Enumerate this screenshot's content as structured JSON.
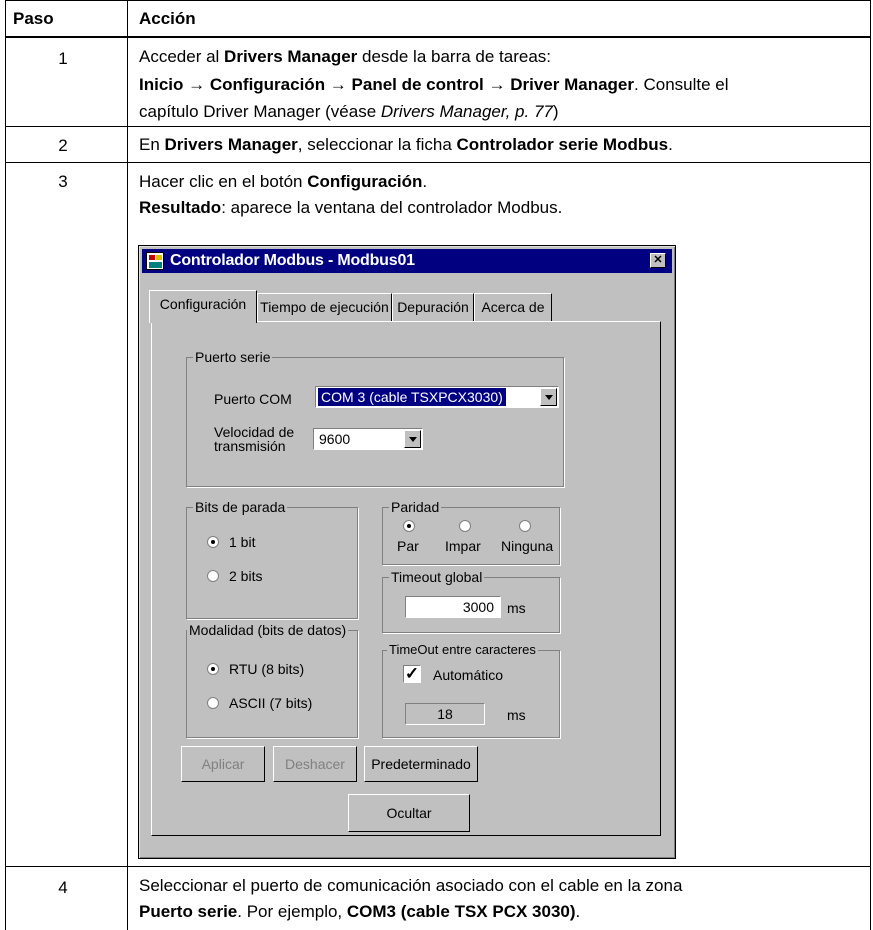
{
  "table": {
    "header": {
      "step": "Paso",
      "action": "Acción"
    },
    "rows": [
      {
        "step": "1",
        "l1": [
          "Acceder al ",
          "Drivers Manager",
          " desde la barra de tareas:"
        ],
        "l2": [
          "Inicio",
          " → ",
          "Configuración",
          " → ",
          "Panel de control",
          " → ",
          "Driver Manager",
          ". Consulte el"
        ],
        "l3": [
          "capítulo Driver Manager (véase ",
          "Drivers Manager, p. 77",
          ")"
        ]
      },
      {
        "step": "2",
        "l1": [
          "En ",
          "Drivers Manager",
          ", seleccionar la ficha ",
          "Controlador serie Modbus",
          "."
        ]
      },
      {
        "step": "3",
        "l1": [
          "Hacer clic en el botón ",
          "Configuración",
          "."
        ],
        "l2": [
          "Resultado",
          ": aparece la ventana del controlador Modbus."
        ]
      },
      {
        "step": "4",
        "l1": [
          "Seleccionar el puerto de comunicación asociado con el cable en la zona"
        ],
        "l2": [
          "Puerto serie",
          ". Por ejemplo, ",
          "COM3 (cable TSX PCX 3030)",
          "."
        ]
      }
    ]
  },
  "dialog": {
    "title": "Controlador Modbus - Modbus01",
    "close_glyph": "✕",
    "tabs": [
      "Configuración",
      "Tiempo de ejecución",
      "Depuración",
      "Acerca de"
    ],
    "puerto_serie": {
      "label": "Puerto serie",
      "com_label": "Puerto COM",
      "com_value": "COM 3 (cable TSXPCX3030)",
      "speed_label_1": "Velocidad de",
      "speed_label_2": "transmisión",
      "speed_value": "9600"
    },
    "bits_parada": {
      "label": "Bits de parada",
      "options": [
        "1 bit",
        "2 bits"
      ],
      "selected": 0
    },
    "paridad": {
      "label": "Paridad",
      "options": [
        "Par",
        "Impar",
        "Ninguna"
      ],
      "selected": 0
    },
    "timeout_global": {
      "label": "Timeout global",
      "value": "3000",
      "unit": "ms"
    },
    "modalidad": {
      "label": "Modalidad (bits de datos)",
      "options": [
        "RTU (8 bits)",
        "ASCII (7 bits)"
      ],
      "selected": 0
    },
    "timeout_chars": {
      "label": "TimeOut entre caracteres",
      "auto_label": "Automático",
      "auto_checked": true,
      "value": "18",
      "unit": "ms",
      "check_glyph": "✓"
    },
    "buttons": {
      "apply": "Aplicar",
      "undo": "Deshacer",
      "default": "Predeterminado",
      "hide": "Ocultar"
    }
  }
}
